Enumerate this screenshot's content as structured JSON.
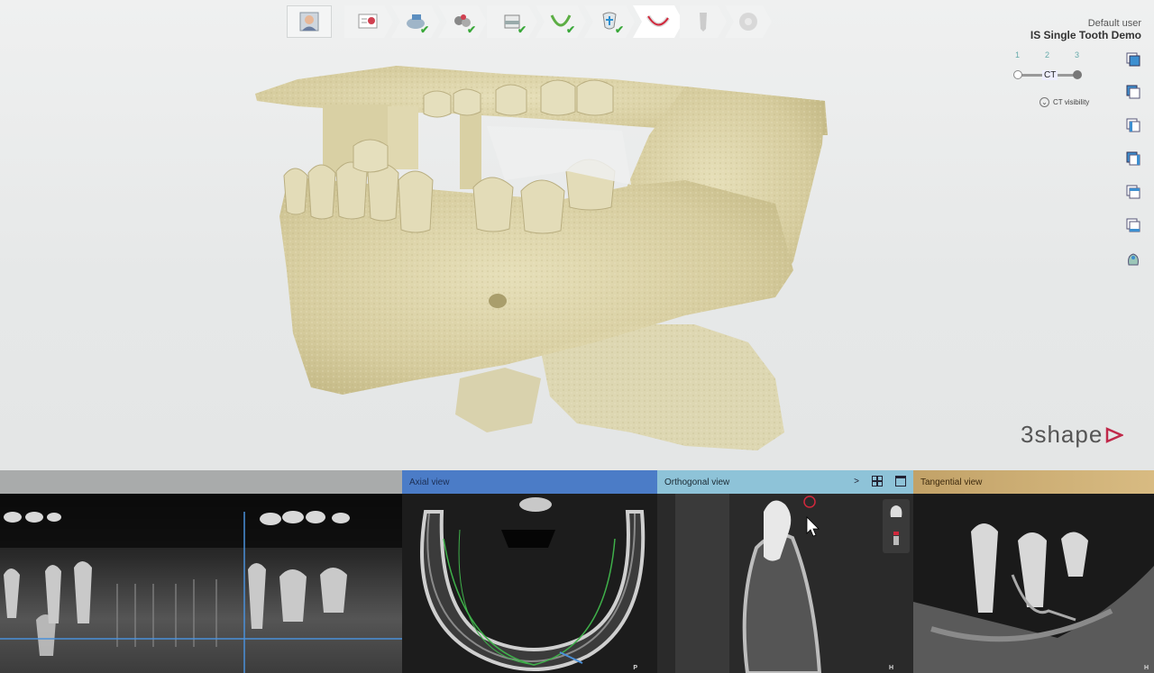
{
  "app": {
    "user_label": "Default user",
    "project_name": "IS Single Tooth Demo",
    "brand_name": "3shape"
  },
  "workflow": {
    "steps": [
      {
        "name": "patient",
        "icon": "patient-photo-icon",
        "completed": false
      },
      {
        "name": "order",
        "icon": "order-form-icon",
        "completed": false
      },
      {
        "name": "import-ct",
        "icon": "ct-import-icon",
        "completed": true
      },
      {
        "name": "import-scan",
        "icon": "scan-import-icon",
        "completed": true
      },
      {
        "name": "segmentation",
        "icon": "segmentation-icon",
        "completed": true
      },
      {
        "name": "panoramic-curve",
        "icon": "arch-curve-icon",
        "completed": true
      },
      {
        "name": "alignment",
        "icon": "alignment-icon",
        "completed": true
      },
      {
        "name": "nerve",
        "icon": "nerve-canal-icon",
        "completed": false
      },
      {
        "name": "implant",
        "icon": "implant-icon",
        "completed": false
      },
      {
        "name": "guide",
        "icon": "guide-icon",
        "completed": false
      }
    ]
  },
  "ct_control": {
    "numbers": [
      "1",
      "2",
      "3"
    ],
    "label": "CT",
    "visibility_label": "CT visibility"
  },
  "side_tools": [
    "view-front-icon",
    "view-back-icon",
    "view-left-icon",
    "view-right-icon",
    "view-top-icon",
    "view-bottom-icon",
    "screenshot-icon"
  ],
  "panels": {
    "panoramic": {
      "title": ""
    },
    "axial": {
      "title": "Axial view",
      "corner": "P"
    },
    "orthogonal": {
      "title": "Orthogonal view",
      "next_label": ">",
      "corner": "H"
    },
    "tangential": {
      "title": "Tangential view",
      "corner": "H"
    }
  },
  "colors": {
    "bone": "#d8cfa4",
    "axial_header": "#4b7cc7",
    "orthogonal_header": "#8ec3d8",
    "tangential_header": "#c2a268",
    "crosshair": "#4a90d9",
    "check": "#3aa83a",
    "brand_accent": "#c0294a"
  }
}
